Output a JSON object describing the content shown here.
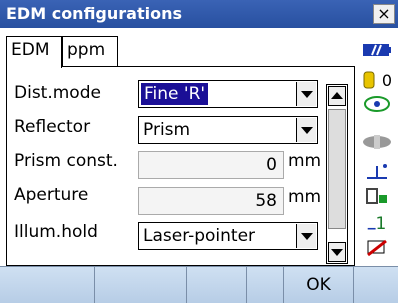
{
  "window": {
    "title": "EDM configurations",
    "close": "×"
  },
  "tabs": [
    {
      "label": "EDM"
    },
    {
      "label": "ppm"
    }
  ],
  "form": {
    "dist_mode_label": "Dist.mode",
    "dist_mode_value": "Fine 'R'",
    "reflector_label": "Reflector",
    "reflector_value": "Prism",
    "prism_const_label": "Prism const.",
    "prism_const_value": "0",
    "prism_const_unit": "mm",
    "aperture_label": "Aperture",
    "aperture_value": "58",
    "aperture_unit": "mm",
    "illum_label": "Illum.hold",
    "illum_value": "Laser-pointer"
  },
  "sidebar": {
    "sun_text": "0",
    "number_text": "1"
  },
  "softkeys": [
    "",
    "",
    "",
    "",
    "OK",
    ""
  ]
}
